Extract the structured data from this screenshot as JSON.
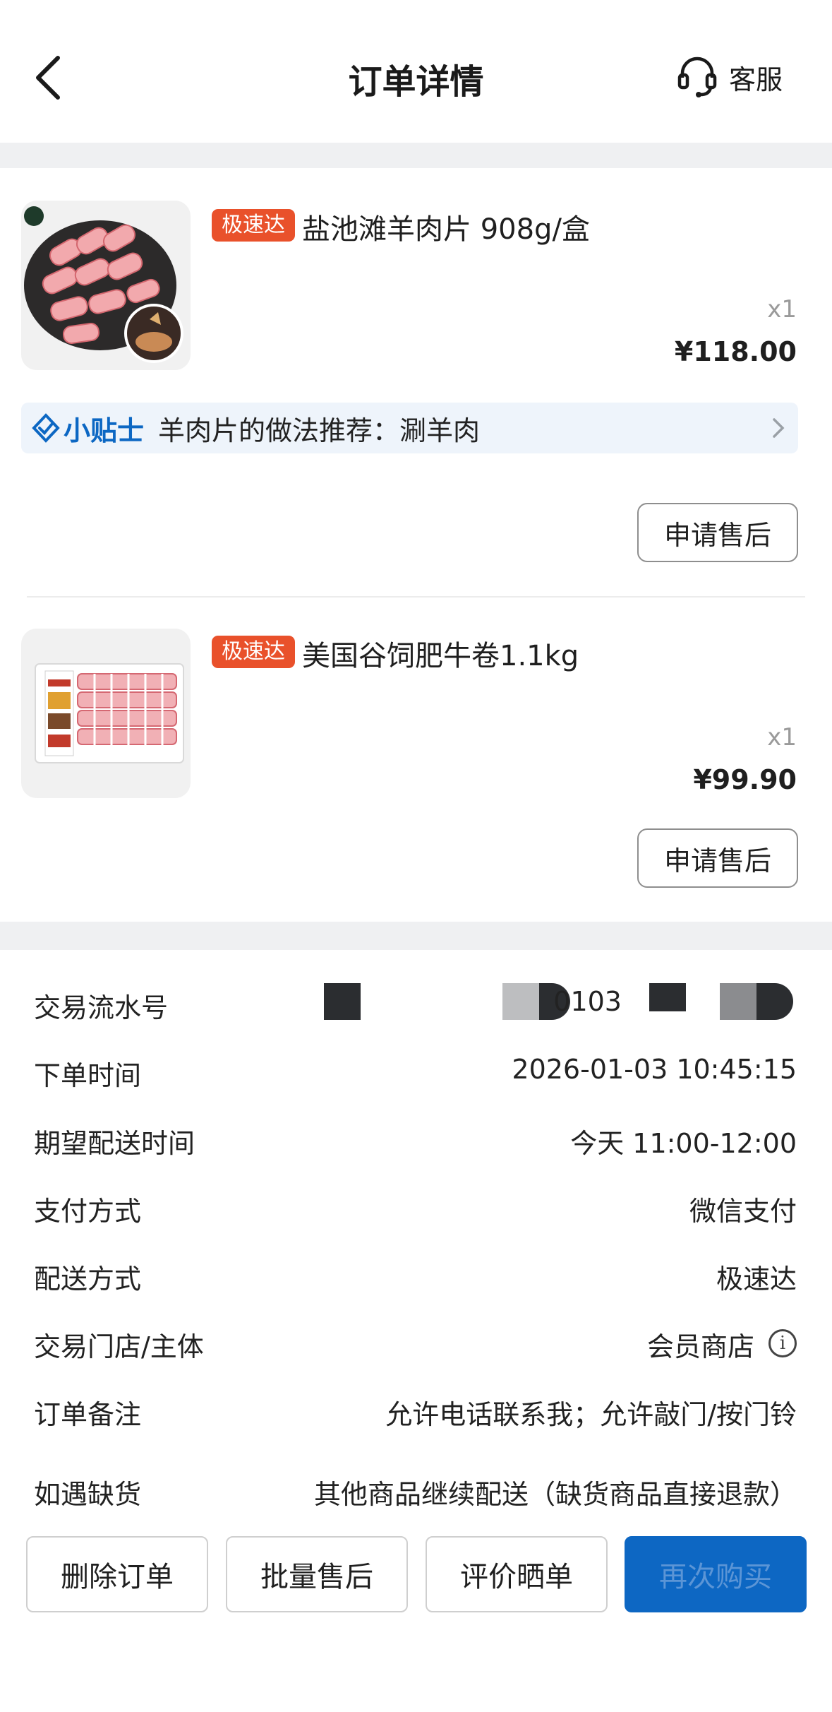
{
  "header": {
    "title": "订单详情",
    "service_label": "客服"
  },
  "products": [
    {
      "tag": "极速达",
      "name": "盐池滩羊肉片 908g/盒",
      "qty": "x1",
      "price": "¥118.00",
      "after_sale": "申请售后"
    },
    {
      "tag": "极速达",
      "name": "美国谷饲肥牛卷1.1kg",
      "qty": "x1",
      "price": "¥99.90",
      "after_sale": "申请售后"
    }
  ],
  "tip": {
    "brand": "小贴士",
    "text": "羊肉片的做法推荐：涮羊肉"
  },
  "info": {
    "serial_label": "交易流水号",
    "serial_value": "0103",
    "order_time_label": "下单时间",
    "order_time_value": "2026-01-03 10:45:15",
    "delivery_time_label": "期望配送时间",
    "delivery_time_value": "今天 11:00-12:00",
    "payment_label": "支付方式",
    "payment_value": "微信支付",
    "delivery_method_label": "配送方式",
    "delivery_method_value": "极速达",
    "store_label": "交易门店/主体",
    "store_value": "会员商店",
    "note_label": "订单备注",
    "note_value": "允许电话联系我；允许敲门/按门铃",
    "stockout_label": "如遇缺货",
    "stockout_value": "其他商品继续配送（缺货商品直接退款）"
  },
  "actions": {
    "delete": "删除订单",
    "batch_after_sale": "批量售后",
    "review": "评价晒单",
    "primary": "再次购买"
  },
  "colors": {
    "accent_blue": "#0d67c3",
    "tag_orange": "#e9512b",
    "band_grey": "#eff0f2"
  }
}
